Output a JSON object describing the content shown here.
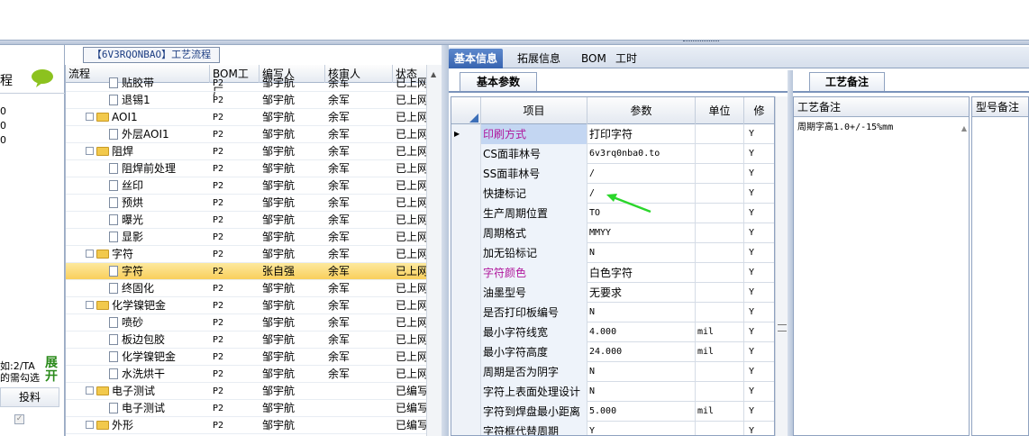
{
  "left_panel": {
    "header_label": "程",
    "values": [
      "0",
      "0",
      "0"
    ],
    "hint_line1": "如:2/TA",
    "hint_line2": "的需勾选",
    "expand_label": "展开",
    "column_label": "投料"
  },
  "flow": {
    "title": "【6V3RQONBAO】工艺流程",
    "columns": [
      "流程",
      "BOM工厂",
      "编写人",
      "核审人",
      "状态"
    ],
    "rows": [
      {
        "name": "贴胶带",
        "type": "doc",
        "level": 2,
        "bom": "P2",
        "writer": "邹宇航",
        "reviewer": "余军",
        "status": "已上网"
      },
      {
        "name": "退锡1",
        "type": "doc",
        "level": 2,
        "bom": "P2",
        "writer": "邹宇航",
        "reviewer": "余军",
        "status": "已上网"
      },
      {
        "name": "AOI1",
        "type": "folder",
        "level": 1,
        "bom": "P2",
        "writer": "邹宇航",
        "reviewer": "余军",
        "status": "已上网"
      },
      {
        "name": "外层AOI1",
        "type": "doc",
        "level": 2,
        "bom": "P2",
        "writer": "邹宇航",
        "reviewer": "余军",
        "status": "已上网"
      },
      {
        "name": "阻焊",
        "type": "folder",
        "level": 1,
        "bom": "P2",
        "writer": "邹宇航",
        "reviewer": "余军",
        "status": "已上网"
      },
      {
        "name": "阻焊前处理",
        "type": "doc",
        "level": 2,
        "bom": "P2",
        "writer": "邹宇航",
        "reviewer": "余军",
        "status": "已上网"
      },
      {
        "name": "丝印",
        "type": "doc",
        "level": 2,
        "bom": "P2",
        "writer": "邹宇航",
        "reviewer": "余军",
        "status": "已上网"
      },
      {
        "name": "预烘",
        "type": "doc",
        "level": 2,
        "bom": "P2",
        "writer": "邹宇航",
        "reviewer": "余军",
        "status": "已上网"
      },
      {
        "name": "曝光",
        "type": "doc",
        "level": 2,
        "bom": "P2",
        "writer": "邹宇航",
        "reviewer": "余军",
        "status": "已上网"
      },
      {
        "name": "显影",
        "type": "doc",
        "level": 2,
        "bom": "P2",
        "writer": "邹宇航",
        "reviewer": "余军",
        "status": "已上网"
      },
      {
        "name": "字符",
        "type": "folder",
        "level": 1,
        "bom": "P2",
        "writer": "邹宇航",
        "reviewer": "余军",
        "status": "已上网"
      },
      {
        "name": "字符",
        "type": "doc",
        "level": 2,
        "bom": "P2",
        "writer": "张自强",
        "reviewer": "余军",
        "status": "已上网",
        "selected": true
      },
      {
        "name": "终固化",
        "type": "doc",
        "level": 2,
        "bom": "P2",
        "writer": "邹宇航",
        "reviewer": "余军",
        "status": "已上网"
      },
      {
        "name": "化学镍钯金",
        "type": "folder",
        "level": 1,
        "bom": "P2",
        "writer": "邹宇航",
        "reviewer": "余军",
        "status": "已上网"
      },
      {
        "name": "喷砂",
        "type": "doc",
        "level": 2,
        "bom": "P2",
        "writer": "邹宇航",
        "reviewer": "余军",
        "status": "已上网"
      },
      {
        "name": "板边包胶",
        "type": "doc",
        "level": 2,
        "bom": "P2",
        "writer": "邹宇航",
        "reviewer": "余军",
        "status": "已上网"
      },
      {
        "name": "化学镍钯金",
        "type": "doc",
        "level": 2,
        "bom": "P2",
        "writer": "邹宇航",
        "reviewer": "余军",
        "status": "已上网"
      },
      {
        "name": "水洗烘干",
        "type": "doc",
        "level": 2,
        "bom": "P2",
        "writer": "邹宇航",
        "reviewer": "余军",
        "status": "已上网"
      },
      {
        "name": "电子测试",
        "type": "folder",
        "level": 1,
        "bom": "P2",
        "writer": "邹宇航",
        "reviewer": "",
        "status": "已编写"
      },
      {
        "name": "电子测试",
        "type": "doc",
        "level": 2,
        "bom": "P2",
        "writer": "邹宇航",
        "reviewer": "",
        "status": "已编写"
      },
      {
        "name": "外形",
        "type": "folder",
        "level": 1,
        "bom": "P2",
        "writer": "邹宇航",
        "reviewer": "",
        "status": "已编写"
      }
    ]
  },
  "tabs": [
    "基本信息",
    "拓展信息",
    "BOM",
    "工时"
  ],
  "basic_params": {
    "tab_label": "基本参数",
    "columns": [
      "项目",
      "参数",
      "单位",
      "修"
    ],
    "rows": [
      {
        "item": "印刷方式",
        "value": "打印字符",
        "unit": "",
        "flag": "Y",
        "highlight": true,
        "current": true
      },
      {
        "item": "CS面菲林号",
        "value": "6v3rq0nba0.to",
        "unit": "",
        "flag": "Y"
      },
      {
        "item": "SS面菲林号",
        "value": "/",
        "unit": "",
        "flag": "Y"
      },
      {
        "item": "快捷标记",
        "value": "/",
        "unit": "",
        "flag": "Y"
      },
      {
        "item": "生产周期位置",
        "value": "TO",
        "unit": "",
        "flag": "Y"
      },
      {
        "item": "周期格式",
        "value": "MMYY",
        "unit": "",
        "flag": "Y"
      },
      {
        "item": "加无铅标记",
        "value": "N",
        "unit": "",
        "flag": "Y"
      },
      {
        "item": "字符颜色",
        "value": "白色字符",
        "unit": "",
        "flag": "Y",
        "highlight": true
      },
      {
        "item": "油墨型号",
        "value": "无要求",
        "unit": "",
        "flag": "Y"
      },
      {
        "item": "是否打印板编号",
        "value": "N",
        "unit": "",
        "flag": "Y"
      },
      {
        "item": "最小字符线宽",
        "value": "4.000",
        "unit": "mil",
        "flag": "Y"
      },
      {
        "item": "最小字符高度",
        "value": "24.000",
        "unit": "mil",
        "flag": "Y"
      },
      {
        "item": "周期是否为阴字",
        "value": "N",
        "unit": "",
        "flag": "Y"
      },
      {
        "item": "字符上表面处理设计",
        "value": "N",
        "unit": "",
        "flag": "Y"
      },
      {
        "item": "字符到焊盘最小距离",
        "value": "5.000",
        "unit": "mil",
        "flag": "Y"
      },
      {
        "item": "字符框代替周期",
        "value": "Y",
        "unit": "",
        "flag": "Y"
      }
    ]
  },
  "process_notes": {
    "tab_label": "工艺备注",
    "column": "工艺备注",
    "text": "周期字高1.0+/-15%mm",
    "model_column": "型号备注"
  },
  "colors": {
    "highlight_text": "#b0179c",
    "annotation_arrow": "#2bd62b"
  }
}
